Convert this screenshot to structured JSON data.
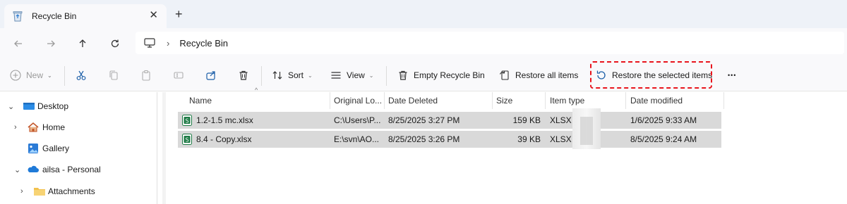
{
  "tab": {
    "title": "Recycle Bin",
    "close": "✕",
    "new_tab": "+"
  },
  "address": {
    "crumb": "Recycle Bin",
    "separator": "›"
  },
  "toolbar": {
    "new_label": "New",
    "sort_label": "Sort",
    "view_label": "View",
    "empty_label": "Empty Recycle Bin",
    "restore_all_label": "Restore all items",
    "restore_selected_label": "Restore the selected items",
    "more_label": "•••",
    "caret": "⌄"
  },
  "sidebar": {
    "items": [
      {
        "label": "Desktop",
        "chevron": "⌄",
        "icon": "desktop-icon"
      },
      {
        "label": "Home",
        "chevron": "›",
        "icon": "home-icon"
      },
      {
        "label": "Gallery",
        "chevron": "",
        "icon": "gallery-icon"
      },
      {
        "label": "ailsa - Personal",
        "chevron": "⌄",
        "icon": "onedrive-icon"
      },
      {
        "label": "Attachments",
        "chevron": "›",
        "icon": "folder-icon"
      }
    ]
  },
  "columns": [
    "Name",
    "Original Lo...",
    "Date Deleted",
    "Size",
    "Item type",
    "Date modified"
  ],
  "sort_indicator": "^",
  "rows": [
    {
      "name": "1.2-1.5 mc.xlsx",
      "original": "C:\\Users\\P...",
      "deleted": "8/25/2025 3:27 PM",
      "size": "159 KB",
      "type": "XLSX",
      "modified": "1/6/2025 9:33 AM"
    },
    {
      "name": "8.4 - Copy.xlsx",
      "original": "E:\\svn\\AO...",
      "deleted": "8/25/2025 3:26 PM",
      "size": "39 KB",
      "type": "XLSX",
      "modified": "8/5/2025 9:24 AM"
    }
  ],
  "colors": {
    "highlight": "#e8141c",
    "selected_row": "#d9d9d9",
    "excel_green": "#1d7a45",
    "folder_yellow": "#f2c14e",
    "onedrive_blue": "#1f7ad8"
  }
}
